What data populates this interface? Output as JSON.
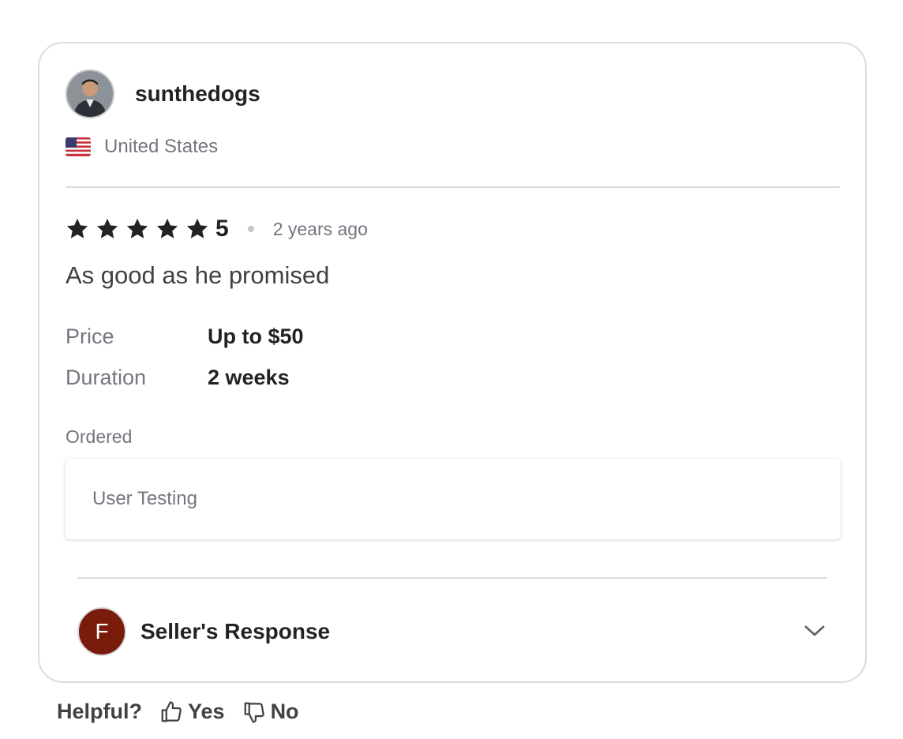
{
  "review": {
    "username": "sunthedogs",
    "country": "United States",
    "rating": 5,
    "rating_label": "5",
    "time_ago": "2 years ago",
    "text": "As good as he promised",
    "meta": [
      {
        "key": "Price",
        "value": "Up to $50"
      },
      {
        "key": "Duration",
        "value": "2 weeks"
      }
    ],
    "ordered_label": "Ordered",
    "ordered_item": "User Testing"
  },
  "seller": {
    "initial": "F",
    "label": "Seller's Response",
    "avatar_color": "#7a1c0c"
  },
  "helpful": {
    "label": "Helpful?",
    "yes": "Yes",
    "no": "No"
  },
  "icons": {
    "star": "star-icon",
    "flag": "us-flag-icon",
    "chevron": "chevron-down-icon",
    "thumbs_up": "thumbs-up-icon",
    "thumbs_down": "thumbs-down-icon"
  }
}
